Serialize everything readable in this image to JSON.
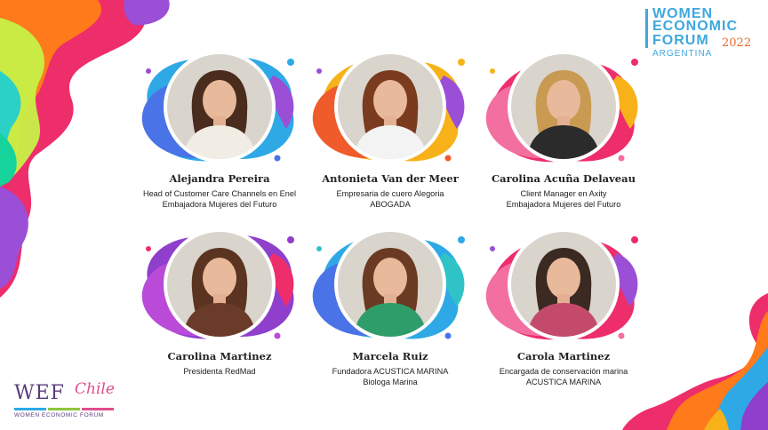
{
  "brand": {
    "women": "WOMEN",
    "economic": "ECONOMIC",
    "forum": "FORUM",
    "year": "2022",
    "country": "ARGENTINA"
  },
  "footer_logo": {
    "wef": "WEF",
    "chile": "Chile",
    "subtitle": "WOMEN ECONOMIC FORUM"
  },
  "speakers": [
    {
      "name": "Alejandra Pereira",
      "role_1": "Head of Customer Care Channels en Enel",
      "role_2": "Embajadora Mujeres del Futuro",
      "blob_colors": [
        "#2ea9e6",
        "#4a73e8",
        "#9b4fd6"
      ],
      "hair": "#4a2c1f",
      "top": "#f1ece4"
    },
    {
      "name": "Antonieta Van der Meer",
      "role_1": "Empresaria de cuero Alegoria",
      "role_2": "ABOGADA",
      "blob_colors": [
        "#f7b21a",
        "#ef5b2b",
        "#9b4fd6"
      ],
      "hair": "#7a3b1e",
      "top": "#f3f3f3"
    },
    {
      "name": "Carolina Acuña Delaveau",
      "role_1": "Client Manager en Axity",
      "role_2": "Embajadora Mujeres del Futuro",
      "blob_colors": [
        "#ee2d6b",
        "#f36fa0",
        "#f7b21a"
      ],
      "hair": "#c89a52",
      "top": "#2b2b2b"
    },
    {
      "name": "Carolina Martinez",
      "role_1": "Presidenta RedMad",
      "role_2": "",
      "blob_colors": [
        "#8f3fcc",
        "#b94bd8",
        "#ee2d6b"
      ],
      "hair": "#5a3420",
      "top": "#6b3b2a"
    },
    {
      "name": "Marcela Ruiz",
      "role_1": "Fundadora ACUSTICA MARINA",
      "role_2": "Biologa Marina",
      "blob_colors": [
        "#2ea9e6",
        "#4a73e8",
        "#2fc3c7"
      ],
      "hair": "#6b3a22",
      "top": "#2e9d6a"
    },
    {
      "name": "Carola Martinez",
      "role_1": "Encargada de conservación marina",
      "role_2": "ACUSTICA MARINA",
      "blob_colors": [
        "#ee2d6b",
        "#f36fa0",
        "#9b4fd6"
      ],
      "hair": "#3a2a22",
      "top": "#c44a6b"
    }
  ]
}
